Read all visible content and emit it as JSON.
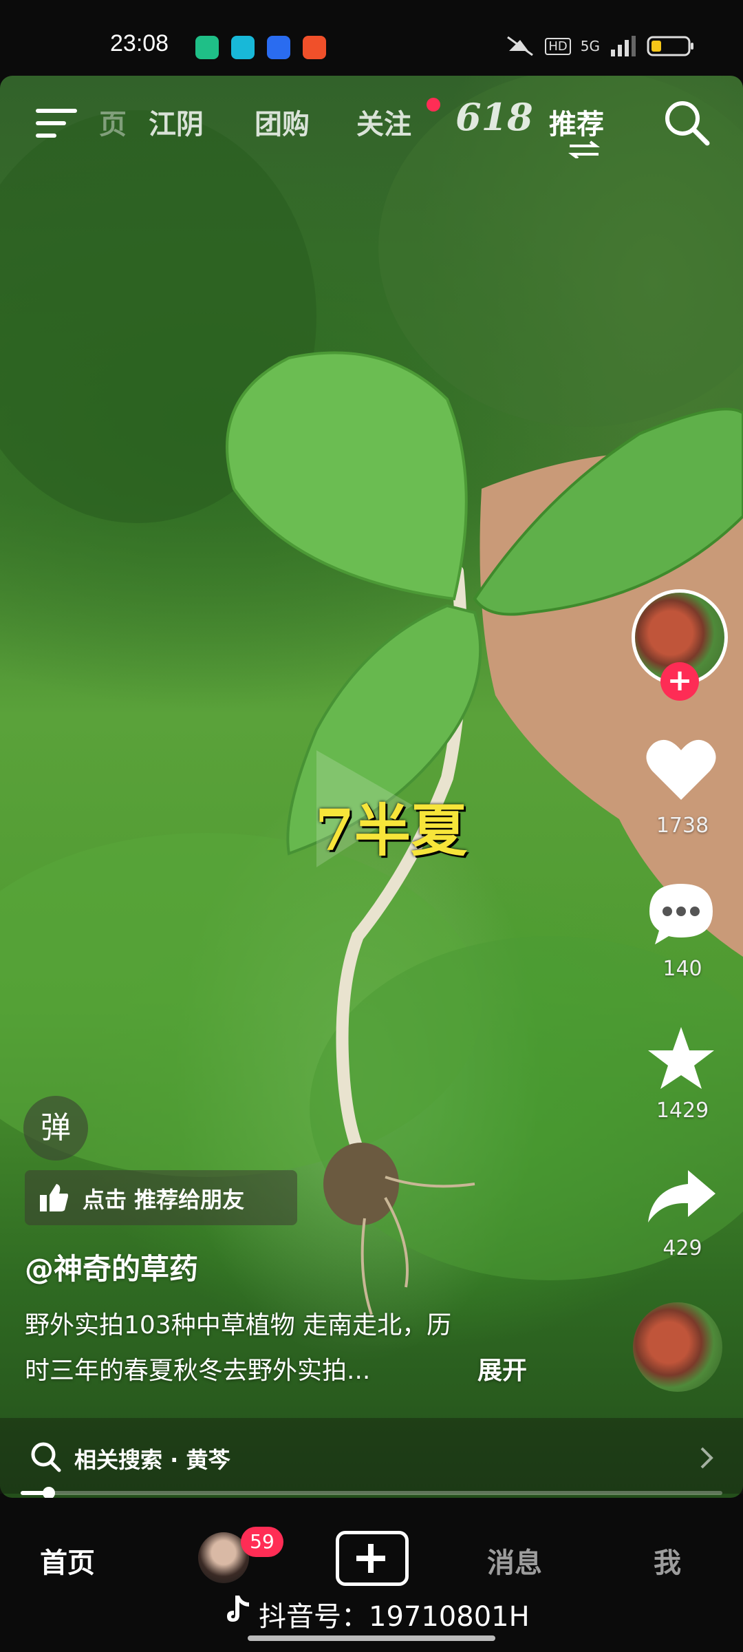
{
  "status": {
    "time": "23:08",
    "hd": "HD",
    "network": "5G"
  },
  "topnav": {
    "tabs": [
      "江阴",
      "团购",
      "关注",
      "618",
      "推荐"
    ],
    "truncated_left": "页"
  },
  "overlay_caption": "7半夏",
  "right": {
    "likes": "1738",
    "comments": "140",
    "favorites": "1429",
    "shares": "429"
  },
  "side_badge": "弹",
  "recommend": "点击 推荐给朋友",
  "username": "@神奇的草药",
  "description": {
    "line1": "野外实拍103种中草植物 走南走北，历",
    "line2": "时三年的春夏秋冬去野外实拍...",
    "expand": "展开"
  },
  "related_search": "相关搜索 · 黄芩",
  "progress": 0.04,
  "bottomnav": {
    "home": "首页",
    "friends_badge": "59",
    "messages": "消息",
    "me": "我",
    "douyin_id": "抖音号：19710801H"
  },
  "colors": {
    "accent": "#fe2c55",
    "badge": "#ff2d55",
    "caption_yellow": "#f7e53a"
  }
}
